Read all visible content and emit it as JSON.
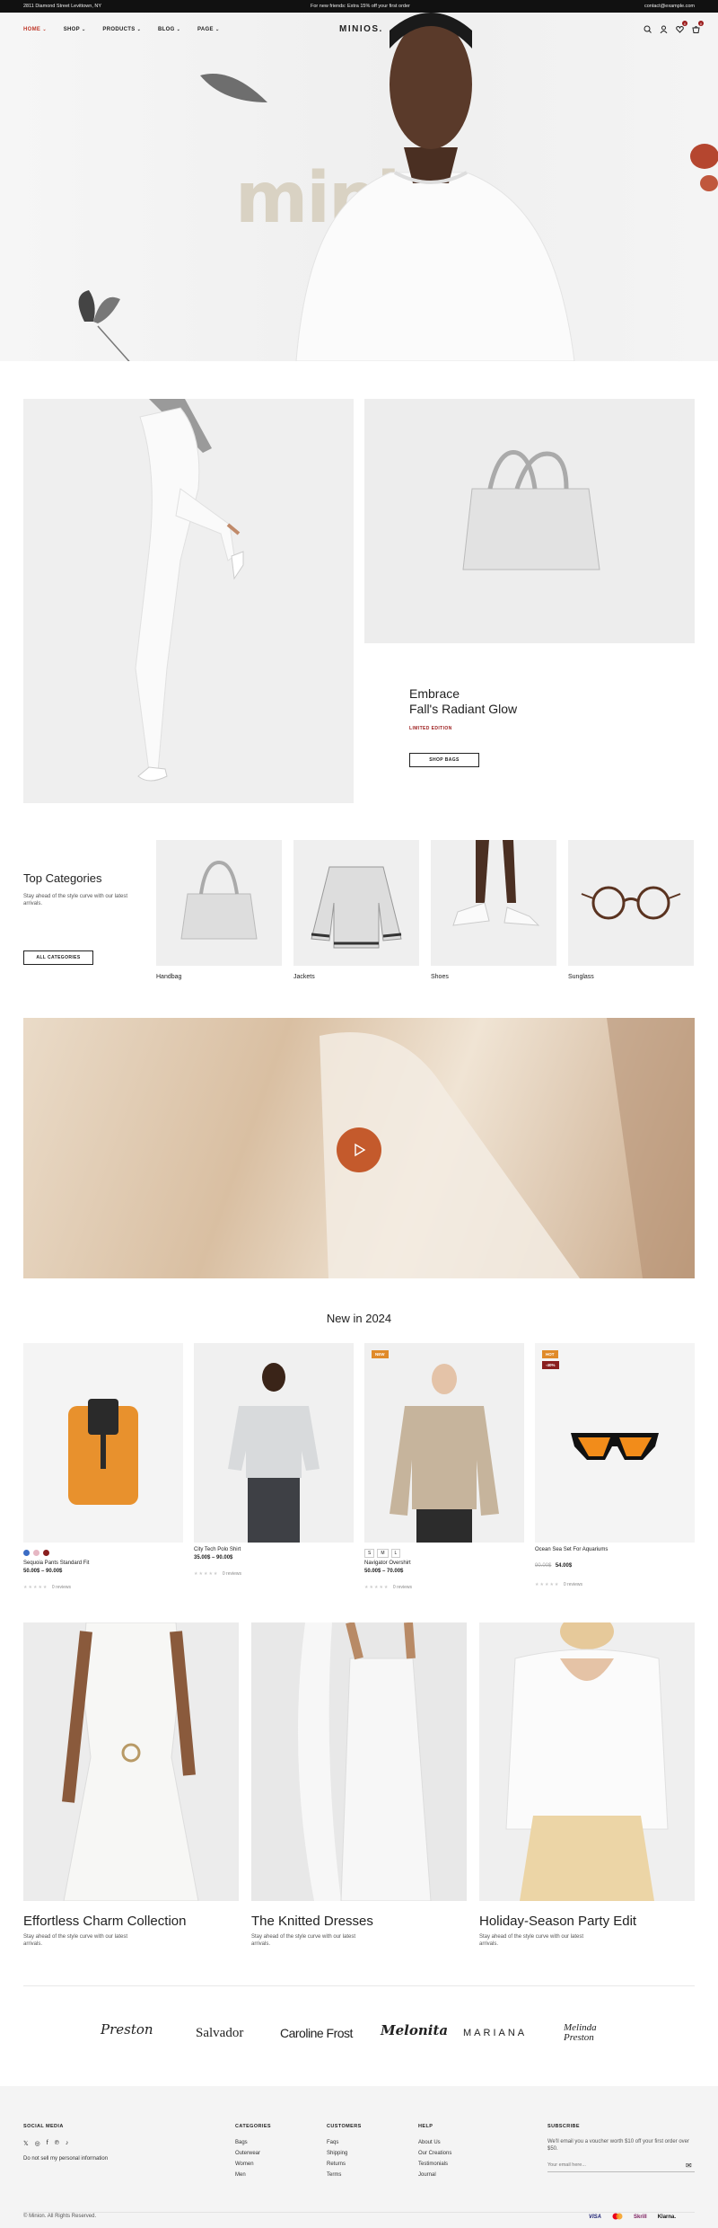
{
  "topbar": {
    "address": "2811 Diamond Street Levittown, NY",
    "promo": "For new friends: Extra 15% off your first order",
    "email": "contact@example.com"
  },
  "header": {
    "logo": "MINIOS.",
    "nav": [
      "HOME",
      "SHOP",
      "PRODUCTS",
      "BLOG",
      "PAGE"
    ],
    "wishlist_count": "0",
    "cart_count": "0"
  },
  "hero": {
    "word": "minion."
  },
  "promo": {
    "title_line1": "Embrace",
    "title_line2": "Fall's Radiant Glow",
    "tag": "LIMITED EDITION",
    "button": "SHOP BAGS"
  },
  "categories": {
    "title": "Top Categories",
    "desc": "Stay ahead of the style curve with our latest arrivals.",
    "button": "ALL CATEGORIES",
    "items": [
      "Handbag",
      "Jackets",
      "Shoes",
      "Sunglass"
    ]
  },
  "new_in": {
    "title": "New in 2024",
    "products": [
      {
        "name": "Sequoia Pants Standard Fit",
        "price": "50.00$ – 90.00$",
        "reviews": "0 reviews"
      },
      {
        "name": "City Tech Polo Shirt",
        "price": "35.00$ – 90.00$",
        "reviews": "0 reviews"
      },
      {
        "name": "Navigator Overshirt",
        "price": "50.00$ – 70.00$",
        "reviews": "0 reviews",
        "badge": "NEW",
        "sizes": [
          "S",
          "M",
          "L"
        ]
      },
      {
        "name": "Ocean Sea Set For Aquariums",
        "old_price": "90.00$",
        "price": "54.00$",
        "reviews": "0 reviews",
        "badge": "HOT",
        "badge2": "-40%"
      }
    ],
    "swatches": [
      "#3b6cc4",
      "#e6b7c3",
      "#8a1f1f"
    ]
  },
  "collections": [
    {
      "title": "Effortless Charm Collection",
      "desc": "Stay ahead of the style curve with our latest arrivals."
    },
    {
      "title": "The Knitted Dresses",
      "desc": "Stay ahead of the style curve with our latest arrivals."
    },
    {
      "title": "Holiday-Season Party Edit",
      "desc": "Stay ahead of the style curve with our latest arrivals."
    }
  ],
  "brands": [
    "Preston",
    "Salvador",
    "Caroline Frost",
    "Melonita",
    "MARIANA",
    "Melinda Preston"
  ],
  "footer": {
    "social_title": "SOCIAL MEDIA",
    "privacy": "Do not sell my personal information",
    "categories_title": "CATEGORIES",
    "categories": [
      "Bags",
      "Outerwear",
      "Women",
      "Men"
    ],
    "customers_title": "CUSTOMERS",
    "customers": [
      "Faqs",
      "Shipping",
      "Returns",
      "Terms"
    ],
    "help_title": "HELP",
    "help": [
      "About Us",
      "Our Creations",
      "Testimonials",
      "Journal"
    ],
    "subscribe_title": "SUBSCRIBE",
    "subscribe_text": "We'll email you a voucher worth $10 off your first order over $50.",
    "email_placeholder": "Your email here...",
    "copyright": "© Minion. All Rights Reserved.",
    "payments": [
      "VISA",
      "Skrill",
      "Klarna."
    ]
  }
}
